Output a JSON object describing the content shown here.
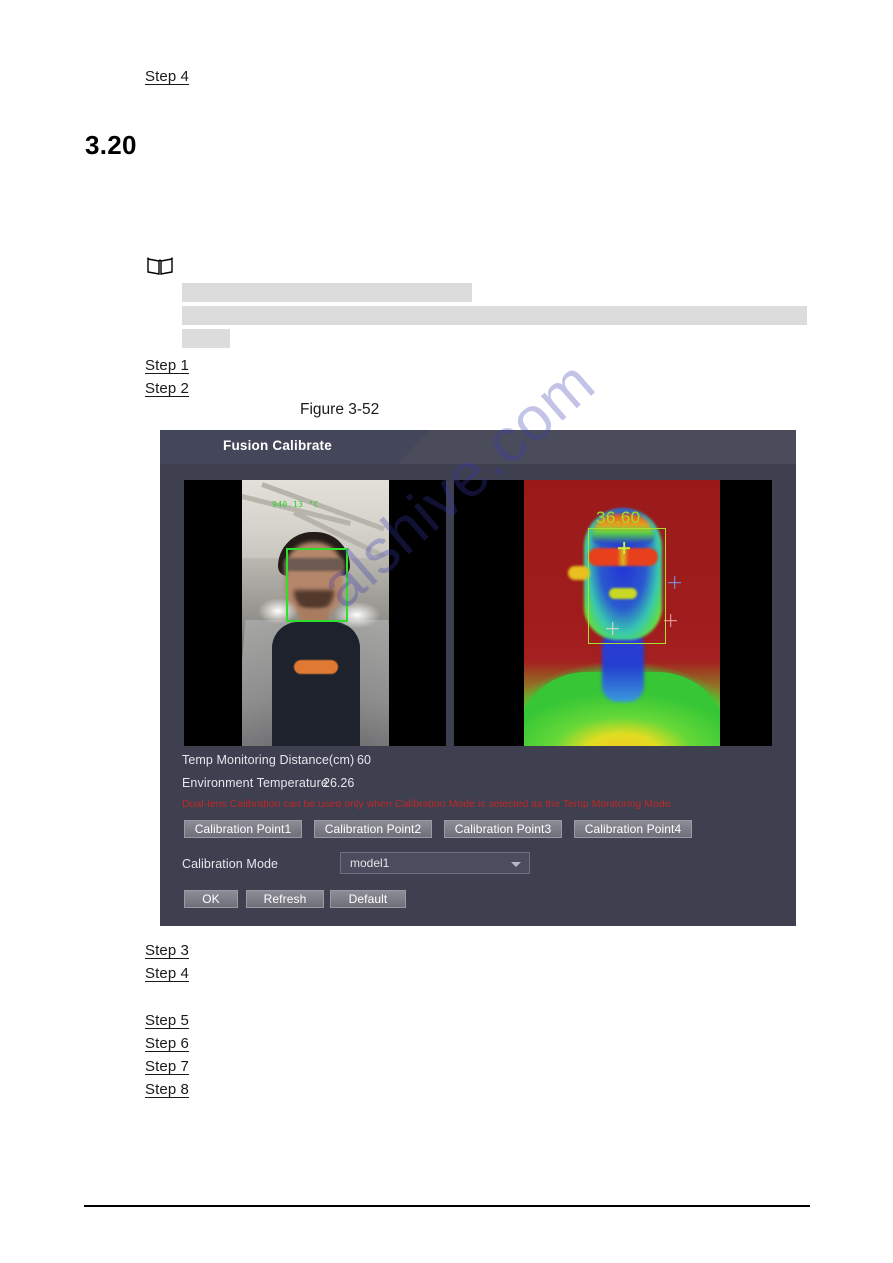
{
  "document": {
    "heading": "3.20",
    "figure_caption": "Figure 3-52",
    "steps_top": [
      "Step 4"
    ],
    "steps_before_figure": [
      "Step 1",
      "Step 2"
    ],
    "steps_after_figure": [
      "Step 3",
      "Step 4"
    ],
    "steps_tail": [
      "Step 5",
      "Step 6",
      "Step 7",
      "Step 8"
    ],
    "note_icon": "book-note-icon",
    "watermark": "alshive.com"
  },
  "dialog": {
    "title": "Fusion Calibrate",
    "preview": {
      "visible_light": {
        "osd_text": "940.13 °C",
        "face_box": "green-detection-box"
      },
      "thermal": {
        "temperature_label": "36.60",
        "face_box": "green-detection-box",
        "markers": [
          "diamond-marker",
          "plus-marker-blue",
          "plus-marker-white",
          "plus-marker-pink"
        ]
      }
    },
    "fields": [
      {
        "label": "Temp Monitoring Distance(cm)",
        "value": "60"
      },
      {
        "label": "Environment Temperature",
        "value": "26.26"
      }
    ],
    "warning": "Dual-lens Calibration can be used only when Calibration Mode is selected as the Temp Monitoring Mode.",
    "calibration_points": [
      "Calibration Point1",
      "Calibration Point2",
      "Calibration Point3",
      "Calibration Point4"
    ],
    "calibration_mode": {
      "label": "Calibration Mode",
      "selected": "model1"
    },
    "actions": [
      "OK",
      "Refresh",
      "Default"
    ]
  },
  "colors": {
    "dialog_bg": "#3e4050",
    "titlebar": "#4a4c5c",
    "warning_red": "#c12626",
    "detection_green": "#2ee02e",
    "thermal_label_green": "#9fe02a",
    "watermark_blue": "#3838b4"
  }
}
